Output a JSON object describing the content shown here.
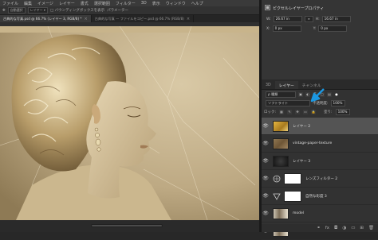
{
  "menubar": {
    "items": [
      "ファイル",
      "編集",
      "イメージ",
      "レイヤー",
      "書式",
      "選択範囲",
      "フィルター",
      "3D",
      "表示",
      "ウィンドウ",
      "ヘルプ"
    ]
  },
  "options": {
    "mode_label": "パラメーター",
    "tool_text": "自動選択",
    "ob2": "レイヤー ▾",
    "ob3": "□ バウンディングボックスを表示"
  },
  "doc_tabs": [
    {
      "label": "古典的な写真.psd @ 66.7% (レイヤー 3, RGB/8) *"
    },
    {
      "label": "古典的な写真 — ファイルをコピー.psd @ 66.7% (RGB/8)"
    }
  ],
  "properties": {
    "title": "ピクセルレイヤープロパティ",
    "w_label": "W:",
    "w_value": "26.67 in",
    "h_label": "H:",
    "h_value": "16.67 in",
    "x_label": "X:",
    "x_value": "0 px",
    "y_label": "Y:",
    "y_value": "0 px"
  },
  "layers_panel": {
    "tabs": [
      "3D",
      "レイヤー",
      "チャンネル"
    ],
    "filter_label": "ρ 種類",
    "blend_mode": "ソフトライト",
    "opacity_label": "不透明度:",
    "opacity_value": "100%",
    "lock_label": "ロック:",
    "fill_label": "塗り:",
    "fill_value": "100%",
    "layers": [
      {
        "name": "レイヤー 2",
        "selected": true,
        "kind": "gold"
      },
      {
        "name": "vintage-paper-texture",
        "selected": false,
        "kind": "paper"
      },
      {
        "name": "レイヤー 3",
        "selected": false,
        "kind": "dark"
      },
      {
        "name": "レンズフィルター 2",
        "selected": false,
        "kind": "adj-lens"
      },
      {
        "name": "自然な彩度 3",
        "selected": false,
        "kind": "adj-vib"
      },
      {
        "name": "model",
        "selected": false,
        "kind": "photo"
      },
      {
        "name": "model",
        "selected": false,
        "kind": "photo"
      }
    ]
  },
  "colors": {
    "accent": "#1c97e0",
    "selected_row": "#545454",
    "panel_bg": "#323232"
  }
}
